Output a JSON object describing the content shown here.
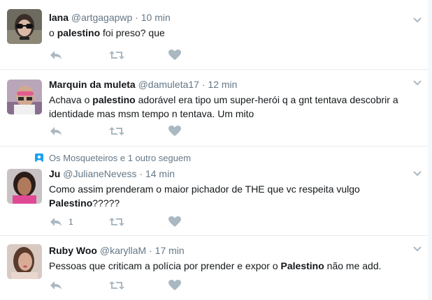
{
  "tweets": [
    {
      "name": "lana",
      "handle": "@artgagapwp",
      "sep": "·",
      "time": "10 min",
      "text_parts": [
        "o ",
        "palestino",
        " foi preso? que"
      ],
      "reply_count": ""
    },
    {
      "name": "Marquin da muleta",
      "handle": "@damuleta17",
      "sep": "·",
      "time": "12 min",
      "text_line1": [
        "Achava o ",
        "palestino",
        " adorável era tipo um super-herói q a gnt  tentava descobrir a"
      ],
      "text_line2": "identidade mas msm tempo n tentava. Um mito",
      "reply_count": ""
    },
    {
      "context": "Os Mosqueteiros e 1 outro seguem",
      "name": "Ju",
      "handle": "@JulianeNevess",
      "sep": "·",
      "time": "14 min",
      "text_line1": "Como assim prenderam o maior pichador de THE que vc respeita vulgo",
      "text_line2": [
        "Palestino",
        "?????"
      ],
      "reply_count": "1"
    },
    {
      "name": "Ruby Woo",
      "handle": "@karyllaM",
      "sep": "·",
      "time": "17 min",
      "text_parts": [
        "Pessoas que criticam a polícia por prender e expor o ",
        "Palestino",
        " não me add."
      ],
      "reply_count": ""
    }
  ],
  "icons": {
    "reply": "reply-icon",
    "retweet": "retweet-icon",
    "like": "heart-icon",
    "more": "chevron-down-icon",
    "follow_context": "person-icon"
  },
  "colors": {
    "icon": "#aab8c2",
    "meta": "#657786",
    "text": "#14171a"
  }
}
